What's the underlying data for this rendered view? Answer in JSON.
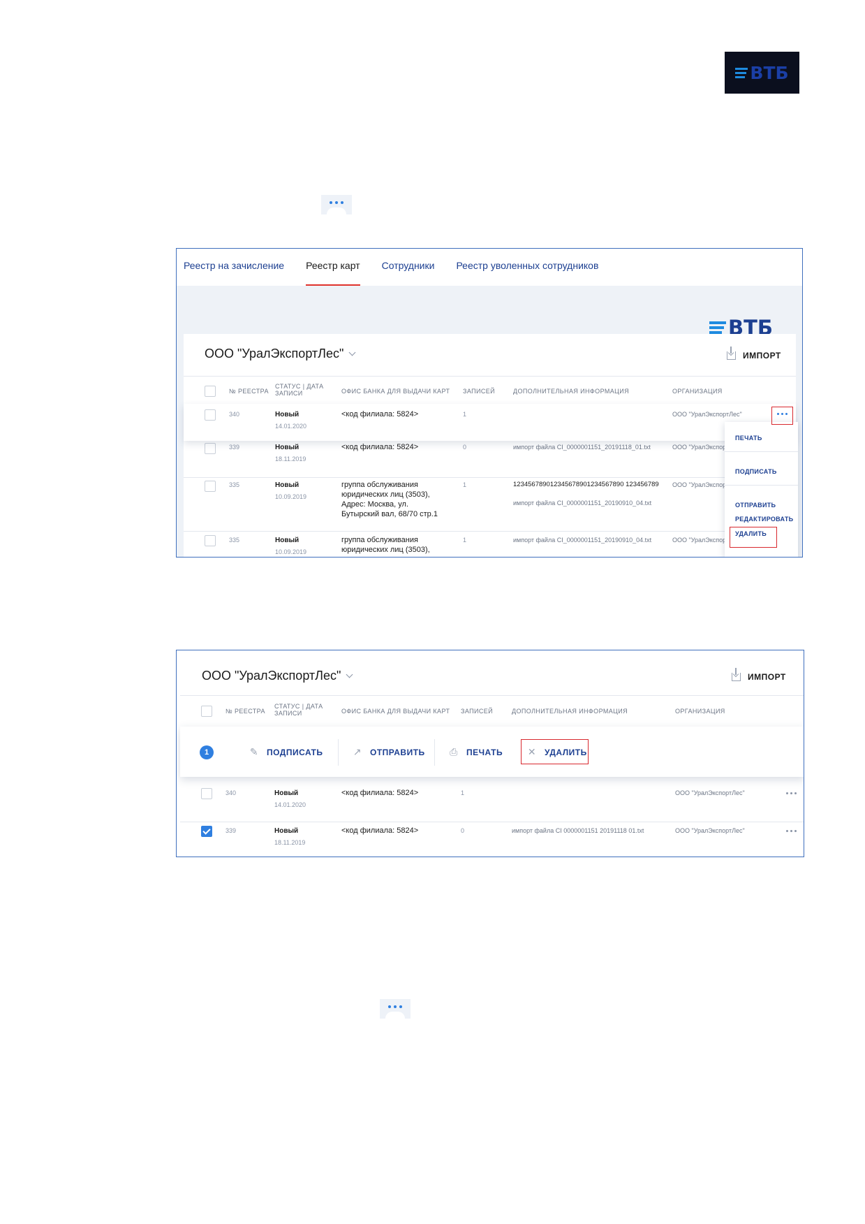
{
  "page_logo": {
    "text": "ВТБ"
  },
  "shot1": {
    "tabs": [
      "Реестр на зачисление",
      "Реестр карт",
      "Сотрудники",
      "Реестр уволенных сотрудников"
    ],
    "band_logo": "ВТБ",
    "org_title": "ООО \"УралЭкспортЛес\"",
    "import_label": "ИМПОРТ",
    "headers": {
      "num": "№ РЕЕСТРА",
      "status": "СТАТУС | ДАТА ЗАПИСИ",
      "office": "ОФИС БАНКА ДЛЯ ВЫДАЧИ КАРТ",
      "records": "ЗАПИСЕЙ",
      "info": "ДОПОЛНИТЕЛЬНАЯ ИНФОРМАЦИЯ",
      "org": "ОРГАНИЗАЦИЯ"
    },
    "rows": [
      {
        "num": "340",
        "status": "Новый",
        "date": "14.01.2020",
        "office": [
          "<код филиала: 5824>"
        ],
        "records": "1",
        "info": [
          "",
          ""
        ],
        "org": "ООО \"УралЭкспортЛес\""
      },
      {
        "num": "339",
        "status": "Новый",
        "date": "18.11.2019",
        "office": [
          "<код филиала: 5824>"
        ],
        "records": "0",
        "info": [
          "импорт файла CI_0000001151_20191118_01.txt",
          ""
        ],
        "org": "ООО \"УралЭкспортЛес\""
      },
      {
        "num": "335",
        "status": "Новый",
        "date": "10.09.2019",
        "office": [
          "группа обслуживания",
          "юридических лиц (3503),",
          "Адрес: Москва, ул.",
          "Бутырский вал, 68/70 стр.1"
        ],
        "records": "1",
        "info": [
          "123456789012345678901234567890 123456789",
          "импорт файла CI_0000001151_20190910_04.txt"
        ],
        "org": "ООО \"УралЭкспортЛес\""
      },
      {
        "num": "335",
        "status": "Новый",
        "date": "10.09.2019",
        "office": [
          "группа обслуживания",
          "юридических лиц (3503),"
        ],
        "records": "1",
        "info": [
          "импорт файла CI_0000001151_20190910_04.txt",
          ""
        ],
        "org": "ООО \"УралЭкспортЛес\""
      }
    ],
    "menu": [
      "ПЕЧАТЬ",
      "ПОДПИСАТЬ",
      "ОТПРАВИТЬ",
      "РЕДАКТИРОВАТЬ",
      "УДАЛИТЬ"
    ]
  },
  "shot2": {
    "org_title": "ООО \"УралЭкспортЛес\"",
    "import_label": "ИМПОРТ",
    "headers": {
      "num": "№ РЕЕСТРА",
      "status": "СТАТУС | ДАТА ЗАПИСИ",
      "office": "ОФИС БАНКА ДЛЯ ВЫДАЧИ КАРТ",
      "records": "ЗАПИСЕЙ",
      "info": "ДОПОЛНИТЕЛЬНАЯ ИНФОРМАЦИЯ",
      "org": "ОРГАНИЗАЦИЯ"
    },
    "selected_count": "1",
    "actions": [
      "ПОДПИСАТЬ",
      "ОТПРАВИТЬ",
      "ПЕЧАТЬ",
      "УДАЛИТЬ"
    ],
    "rows": [
      {
        "num": "340",
        "status": "Новый",
        "date": "14.01.2020",
        "office": "<код филиала: 5824>",
        "records": "1",
        "info": "",
        "org": "ООО \"УралЭкспортЛес\"",
        "checked": false
      },
      {
        "num": "339",
        "status": "Новый",
        "date": "18.11.2019",
        "office": "<код филиала: 5824>",
        "records": "0",
        "info": "импорт файла CI 0000001151 20191118 01.txt",
        "org": "ООО \"УралЭкспортЛес\"",
        "checked": true
      }
    ]
  },
  "colors": {
    "accent": "#2f7fe0",
    "brand": "#1c3f91",
    "highlight": "#d8282e",
    "tab_underline": "#e0332c"
  },
  "icons": [
    "vtb-logo",
    "more-dots-icon",
    "import-icon",
    "chevron-down-icon",
    "sign-icon",
    "send-icon",
    "print-icon",
    "close-icon",
    "checkbox"
  ]
}
